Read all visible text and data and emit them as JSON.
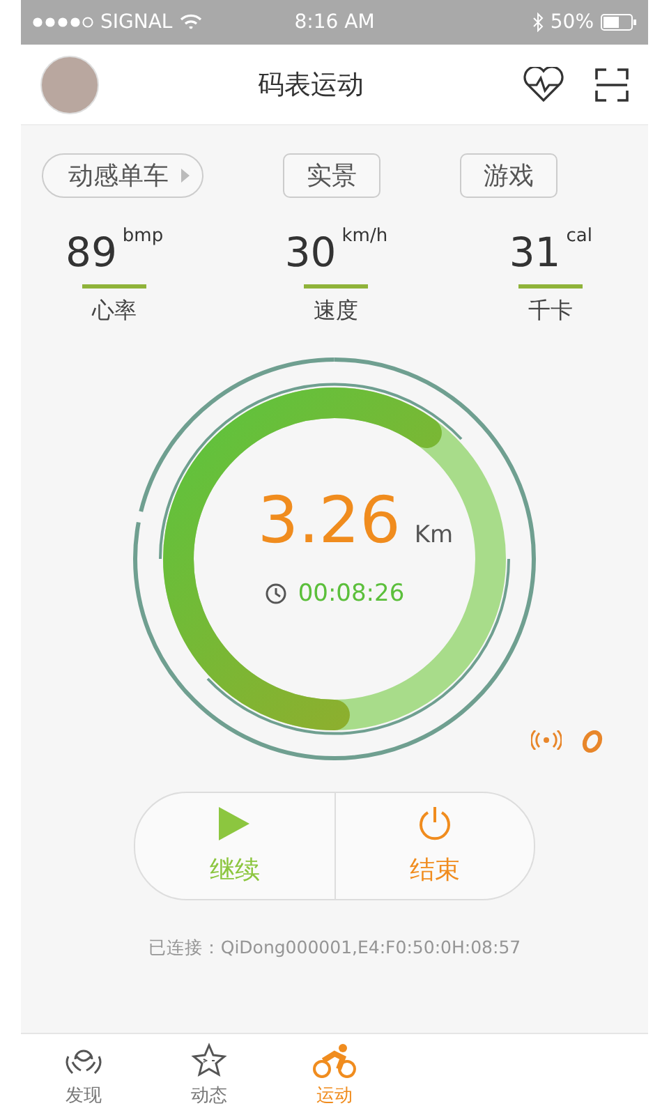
{
  "status_bar": {
    "carrier": "SIGNAL",
    "time": "8:16 AM",
    "battery": "50%"
  },
  "header": {
    "title": "码表运动"
  },
  "modes": [
    {
      "label": "动感单车",
      "kind": "dropdown"
    },
    {
      "label": "实景",
      "kind": "plain"
    },
    {
      "label": "游戏",
      "kind": "plain"
    }
  ],
  "stats": [
    {
      "value": "89",
      "unit": "bmp",
      "label": "心率"
    },
    {
      "value": "30",
      "unit": "km/h",
      "label": "速度"
    },
    {
      "value": "31",
      "unit": "cal",
      "label": "千卡"
    }
  ],
  "gauge": {
    "distance": "3.26",
    "unit": "Km",
    "time": "00:08:26",
    "level": 0.6
  },
  "controls": [
    {
      "label": "继续",
      "kind": "play"
    },
    {
      "label": "结束",
      "kind": "power"
    }
  ],
  "connection": "已连接：QiDong000001,E4:F0:50:0H:08:57",
  "nav": [
    {
      "label": "发现",
      "kind": "discover",
      "selected": false
    },
    {
      "label": "动态",
      "kind": "feed",
      "selected": false
    },
    {
      "label": "运动",
      "kind": "sport",
      "selected": true
    }
  ]
}
